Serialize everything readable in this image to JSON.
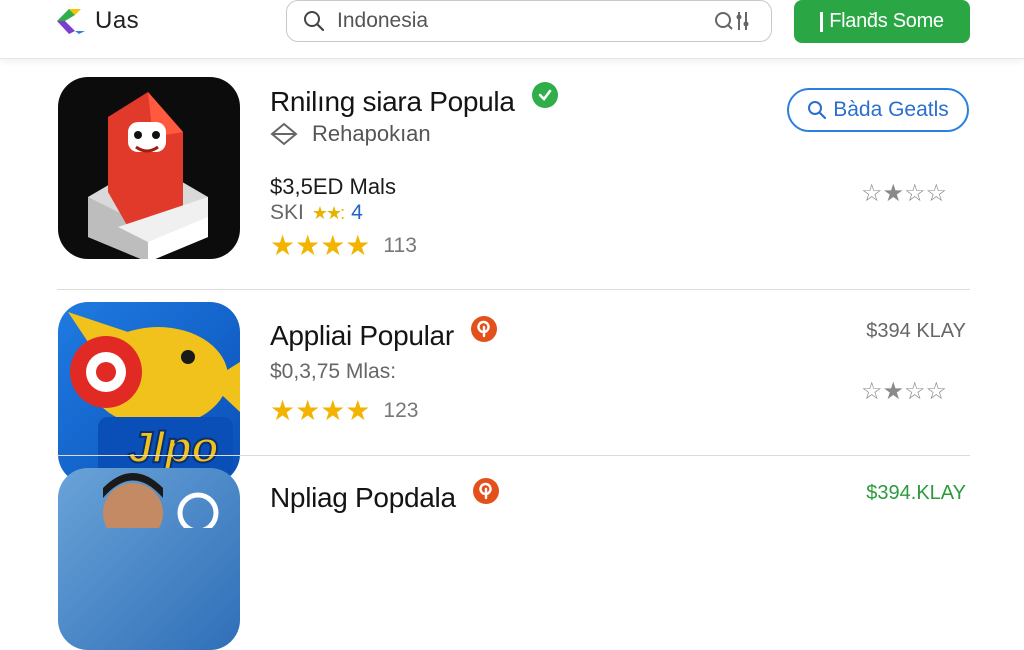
{
  "header": {
    "logo_text": "Uas",
    "search_placeholder": "Indonesia",
    "primary_button_label": "Fland̆s Some"
  },
  "apps": [
    {
      "title": "Rnilıng siara Popula",
      "developer": "Rehapokıan",
      "price": "$3,5ED Mals",
      "sub_label": "SKI",
      "sub_value": "4",
      "stars": "★★★★",
      "rating_count": "113",
      "action_label": "Bàda Geatls",
      "outline_rating": "☆★☆☆",
      "badge_color": "#2fae4a"
    },
    {
      "title": "Appliai Popular",
      "price": "$0,3,75 Mlas:",
      "stars": "★★★★",
      "rating_count": "123",
      "side_price": "$394 KLAY",
      "outline_rating": "☆★☆☆",
      "badge_color": "#e4501c"
    },
    {
      "title": "Npliag Popdala",
      "side_price": "$394.KLAY",
      "badge_color": "#e4501c"
    }
  ],
  "colors": {
    "primary_green": "#2aa744",
    "link_blue": "#2a7fe0",
    "star_yellow": "#f2b400"
  }
}
